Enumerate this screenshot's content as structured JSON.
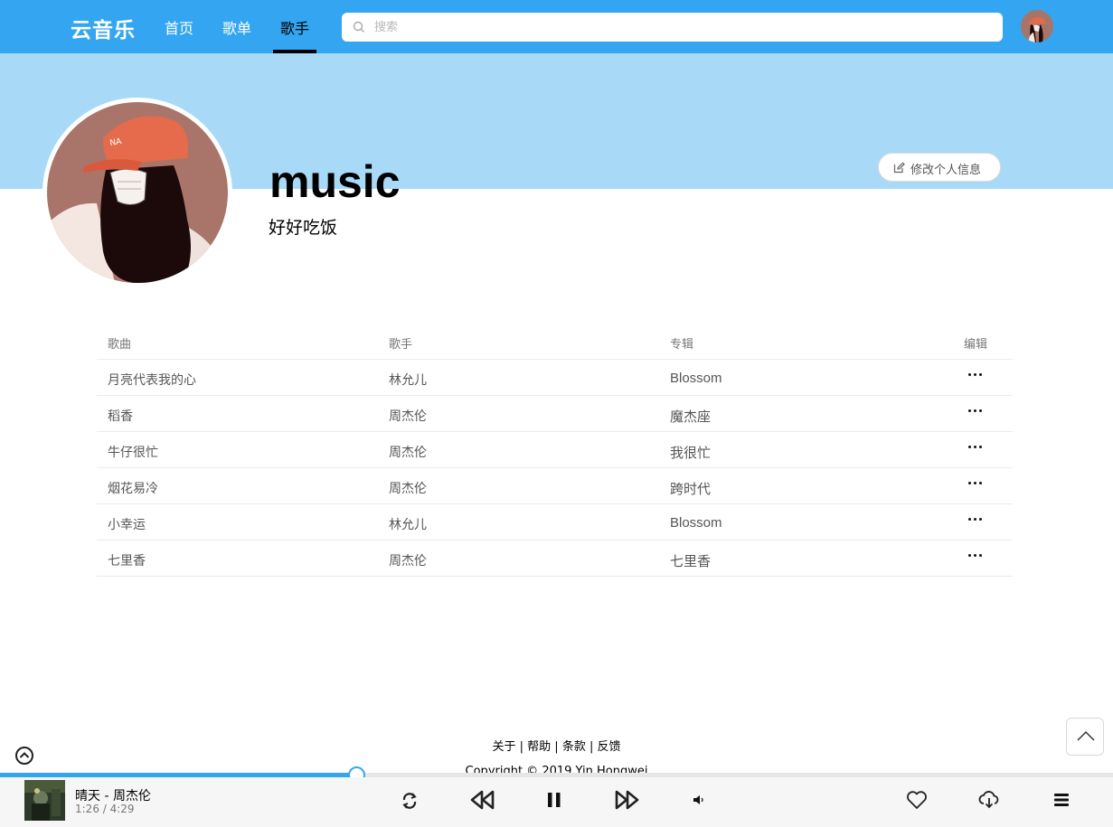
{
  "header": {
    "logo": "云音乐",
    "nav": [
      {
        "label": "首页"
      },
      {
        "label": "歌单"
      },
      {
        "label": "歌手"
      }
    ],
    "search_placeholder": "搜索"
  },
  "profile": {
    "username": "music",
    "signature": "好好吃饭",
    "edit_label": "修改个人信息"
  },
  "table": {
    "headers": {
      "song": "歌曲",
      "artist": "歌手",
      "album": "专辑",
      "edit": "编辑"
    },
    "rows": [
      {
        "song": "月亮代表我的心",
        "artist": "林允儿",
        "album": "Blossom"
      },
      {
        "song": "稻香",
        "artist": "周杰伦",
        "album": "魔杰座"
      },
      {
        "song": "牛仔很忙",
        "artist": "周杰伦",
        "album": "我很忙"
      },
      {
        "song": "烟花易冷",
        "artist": "周杰伦",
        "album": "跨时代"
      },
      {
        "song": "小幸运",
        "artist": "林允儿",
        "album": "Blossom"
      },
      {
        "song": "七里香",
        "artist": "周杰伦",
        "album": "七里香"
      }
    ]
  },
  "footer": {
    "links": [
      "关于",
      "帮助",
      "条款",
      "反馈"
    ],
    "separator": "|",
    "copyright": "Copyright © 2019 Yin Hongwei"
  },
  "player": {
    "title": "晴天 - 周杰伦",
    "time": "1:26 / 4:29",
    "progress": 0.32
  },
  "colors": {
    "primary": "#34a5f1",
    "banner": "#a8d9f7"
  },
  "icons": [
    "search-icon",
    "edit-icon",
    "more-icon",
    "repeat-icon",
    "previous-icon",
    "pause-icon",
    "next-icon",
    "volume-icon",
    "heart-icon",
    "download-icon",
    "playlist-icon",
    "chevron-up-icon"
  ]
}
